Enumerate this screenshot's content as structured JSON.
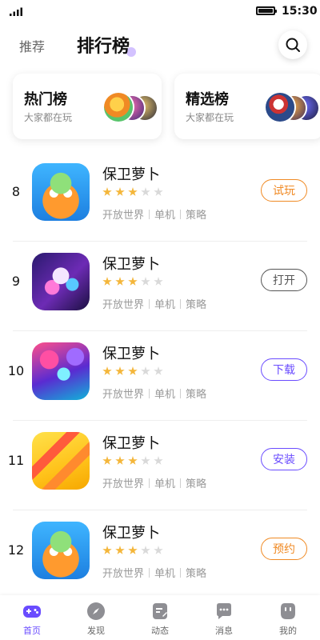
{
  "status_bar": {
    "time": "15:30"
  },
  "header": {
    "tab_recommend": "推荐",
    "tab_ranking": "排行榜"
  },
  "cards": [
    {
      "title": "热门榜",
      "subtitle": "大家都在玩"
    },
    {
      "title": "精选榜",
      "subtitle": "大家都在玩"
    }
  ],
  "games": [
    {
      "rank": "8",
      "name": "保卫萝卜",
      "rating": 3,
      "tags": [
        "开放世界",
        "单机",
        "策略"
      ],
      "action": "试玩",
      "action_color": "#f08a24"
    },
    {
      "rank": "9",
      "name": "保卫萝卜",
      "rating": 3,
      "tags": [
        "开放世界",
        "单机",
        "策略"
      ],
      "action": "打开",
      "action_color": "#555555"
    },
    {
      "rank": "10",
      "name": "保卫萝卜",
      "rating": 3,
      "tags": [
        "开放世界",
        "单机",
        "策略"
      ],
      "action": "下载",
      "action_color": "#6a4cff"
    },
    {
      "rank": "11",
      "name": "保卫萝卜",
      "rating": 3,
      "tags": [
        "开放世界",
        "单机",
        "策略"
      ],
      "action": "安装",
      "action_color": "#6a4cff"
    },
    {
      "rank": "12",
      "name": "保卫萝卜",
      "rating": 3,
      "tags": [
        "开放世界",
        "单机",
        "策略"
      ],
      "action": "预约",
      "action_color": "#f08a24"
    }
  ],
  "tabbar": [
    {
      "label": "首页",
      "icon": "gamepad-icon",
      "active": true
    },
    {
      "label": "发现",
      "icon": "compass-icon",
      "active": false
    },
    {
      "label": "动态",
      "icon": "note-icon",
      "active": false
    },
    {
      "label": "消息",
      "icon": "chat-icon",
      "active": false
    },
    {
      "label": "我的",
      "icon": "profile-icon",
      "active": false
    }
  ],
  "colors": {
    "accent": "#6a4cff",
    "orange": "#f08a24",
    "star": "#f4b63a"
  }
}
